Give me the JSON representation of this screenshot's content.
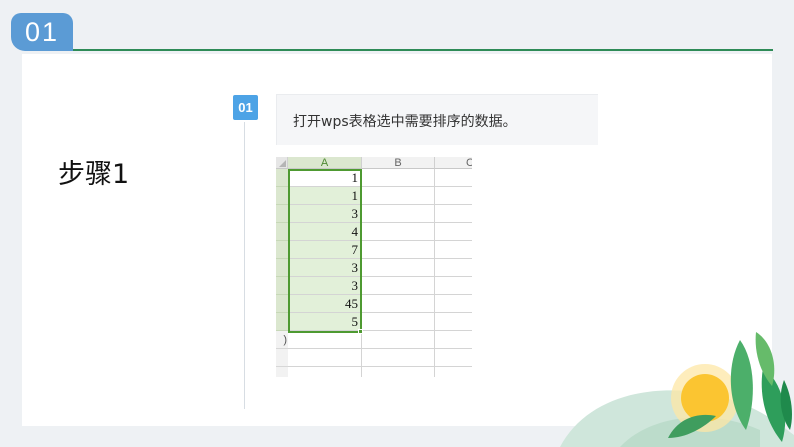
{
  "slide": {
    "number": "01",
    "step_title": "步骤1"
  },
  "step": {
    "badge": "01",
    "instruction": "打开wps表格选中需要排序的数据。"
  },
  "spreadsheet": {
    "columns": [
      "A",
      "B",
      "C"
    ],
    "selected_column": "A",
    "values": [
      "1",
      "1",
      "3",
      "4",
      "7",
      "3",
      "3",
      "45",
      "5"
    ],
    "partial_row_label": ")"
  },
  "colors": {
    "accent": "#5b9bd5",
    "header_line": "#2e8b57",
    "step_badge": "#4da3e6",
    "selection": "#4e9a31",
    "selection_fill": "#e2f0d9"
  },
  "decoration": {
    "icon": "leaves-and-sun"
  }
}
